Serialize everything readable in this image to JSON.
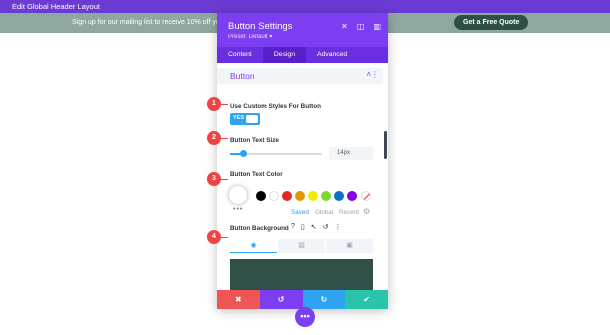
{
  "topbar": {
    "title": "Edit Global Header Layout"
  },
  "banner": {
    "text": "Sign up for our mailing list to receive  10% off your next order",
    "cta": "Get a Free Quote"
  },
  "panel": {
    "title": "Button Settings",
    "preset": "Preset: Default ▾",
    "header_icons": [
      "close-icon",
      "expand-icon",
      "sidebar-icon"
    ],
    "tabs": [
      {
        "label": "Content"
      },
      {
        "label": "Design"
      },
      {
        "label": "Advanced"
      }
    ],
    "active_tab": "Design",
    "section": {
      "title": "Button",
      "chevron": "˄",
      "menu": "⋮"
    },
    "custom_styles": {
      "label": "Use Custom Styles For Button",
      "toggle_text": "YES"
    },
    "text_size": {
      "label": "Button Text Size",
      "value": "14px"
    },
    "text_color": {
      "label": "Button Text Color",
      "swatches": [
        "#000000",
        "#ffffff",
        "#e02b20",
        "#e09900",
        "#edf000",
        "#7cda24",
        "#0c71c3",
        "#8300e9"
      ],
      "more": "•••",
      "tabs": [
        {
          "label": "Saved"
        },
        {
          "label": "Global"
        },
        {
          "label": "Recent"
        }
      ]
    },
    "background": {
      "label": "Button Background",
      "icons": [
        "?",
        "▯",
        "↖",
        "↺",
        "⋮"
      ],
      "tab_icons": [
        "◉",
        "▨",
        "▣"
      ],
      "preview_color": "#2f5147"
    },
    "footer": {
      "cancel": "✖",
      "undo": "↺",
      "redo": "↻",
      "save": "✔"
    }
  },
  "markers": [
    "1",
    "2",
    "3",
    "4"
  ],
  "fab": "•••"
}
